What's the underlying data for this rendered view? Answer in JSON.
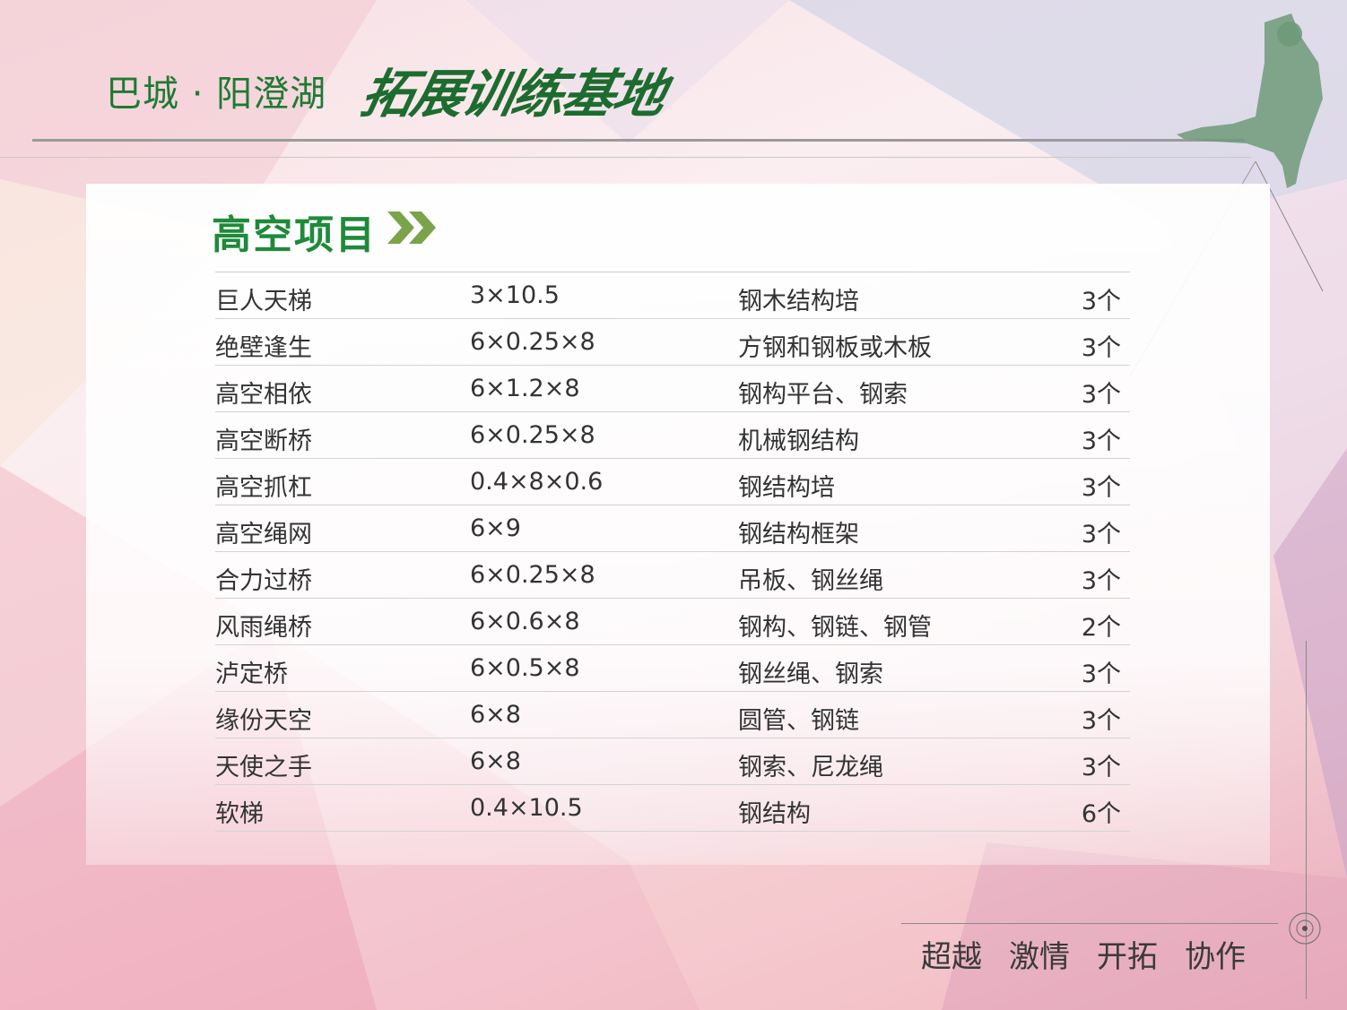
{
  "header": {
    "brand_text": "巴城 · 阳澄湖",
    "brand_script": "拓展训练基地"
  },
  "section": {
    "title": "高空项目"
  },
  "table": {
    "rows": [
      {
        "name": "巨人天梯",
        "size": "3×10.5",
        "material": "钢木结构培",
        "count": "3个"
      },
      {
        "name": "绝壁逢生",
        "size": "6×0.25×8",
        "material": "方钢和钢板或木板",
        "count": "3个"
      },
      {
        "name": "高空相依",
        "size": "6×1.2×8",
        "material": "钢构平台、钢索",
        "count": "3个"
      },
      {
        "name": "高空断桥",
        "size": "6×0.25×8",
        "material": "机械钢结构",
        "count": "3个"
      },
      {
        "name": "高空抓杠",
        "size": "0.4×8×0.6",
        "material": "钢结构培",
        "count": "3个"
      },
      {
        "name": "高空绳网",
        "size": "6×9",
        "material": "钢结构框架",
        "count": "3个"
      },
      {
        "name": "合力过桥",
        "size": "6×0.25×8",
        "material": "吊板、钢丝绳",
        "count": "3个"
      },
      {
        "name": "风雨绳桥",
        "size": "6×0.6×8",
        "material": "钢构、钢链、钢管",
        "count": "2个"
      },
      {
        "name": "泸定桥",
        "size": "6×0.5×8",
        "material": "钢丝绳、钢索",
        "count": "3个"
      },
      {
        "name": "缘份天空",
        "size": "6×8",
        "material": "圆管、钢链",
        "count": "3个"
      },
      {
        "name": "天使之手",
        "size": "6×8",
        "material": "钢索、尼龙绳",
        "count": "3个"
      },
      {
        "name": "软梯",
        "size": "0.4×10.5",
        "material": "钢结构",
        "count": "6个"
      }
    ]
  },
  "footer": {
    "slogans": [
      "超越",
      "激情",
      "开拓",
      "协作"
    ]
  },
  "colors": {
    "brand_green": "#1e7a34",
    "title_green": "#1e8a3a",
    "chevron_green": "#7aa34a"
  }
}
